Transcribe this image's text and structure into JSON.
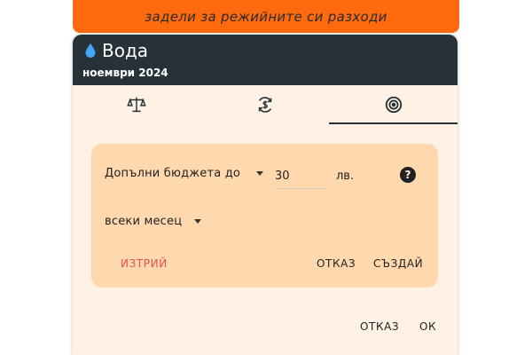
{
  "banner": {
    "text": "задели за режийните си разходи"
  },
  "dialog": {
    "title": "Вода",
    "subtitle": "ноември 2024",
    "tabs": [
      {
        "icon": "balance-scale-icon"
      },
      {
        "icon": "currency-sync-icon"
      },
      {
        "icon": "target-icon",
        "selected": true
      }
    ],
    "budget_card": {
      "dropdown_label": "Допълни бюджета до",
      "amount": "30",
      "currency": "лв.",
      "help_icon": "?",
      "period": "всеки месец",
      "delete_label": "ИЗТРИЙ",
      "cancel_label": "ОТКАЗ",
      "create_label": "СЪЗДАЙ"
    },
    "footer": {
      "cancel_label": "ОТКАЗ",
      "ok_label": "ОК"
    }
  },
  "colors": {
    "banner": "#ff6a0f",
    "header": "#263238",
    "dialog_bg": "#fff1e3",
    "card_bg": "#ffd9ad",
    "delete": "#e8514a",
    "water_drop": "#42a5f5"
  }
}
